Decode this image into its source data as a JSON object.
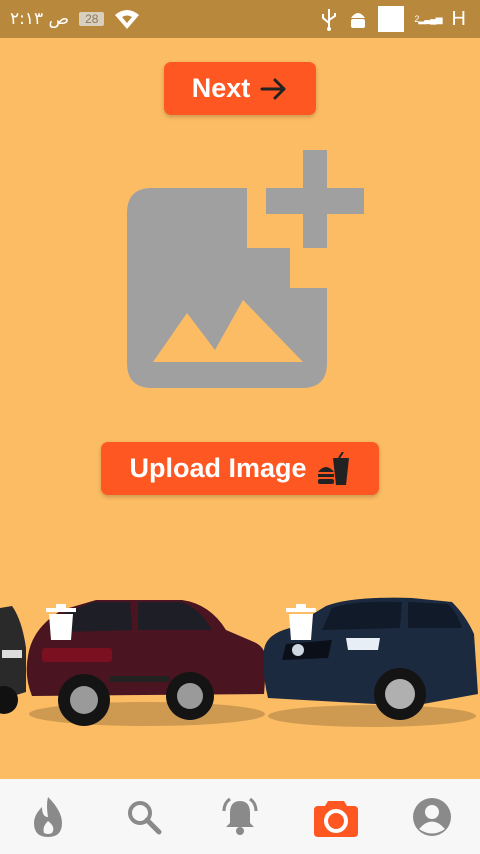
{
  "status_bar": {
    "time": "ص ٢:١٣",
    "battery": "28",
    "signal_label": "2",
    "network": "H"
  },
  "actions": {
    "next_label": "Next",
    "upload_label": "Upload Image"
  },
  "colors": {
    "background": "#FCBC63",
    "accent": "#FF5722",
    "status_bar": "#B8893C",
    "placeholder_icon": "#A0A0A0",
    "nav_icon": "#8A8A8A"
  },
  "icons": {
    "next": "arrow-right-icon",
    "upload": "food-icon",
    "placeholder": "add-image-icon"
  },
  "images": [
    {
      "name": "maroon-suv",
      "delete_icon": "trash-icon"
    },
    {
      "name": "navy-suv",
      "delete_icon": "trash-icon"
    }
  ],
  "bottom_nav": [
    {
      "icon": "flame-icon",
      "active": false
    },
    {
      "icon": "search-icon",
      "active": false
    },
    {
      "icon": "bell-icon",
      "active": false
    },
    {
      "icon": "camera-icon",
      "active": true
    },
    {
      "icon": "profile-icon",
      "active": false
    }
  ]
}
